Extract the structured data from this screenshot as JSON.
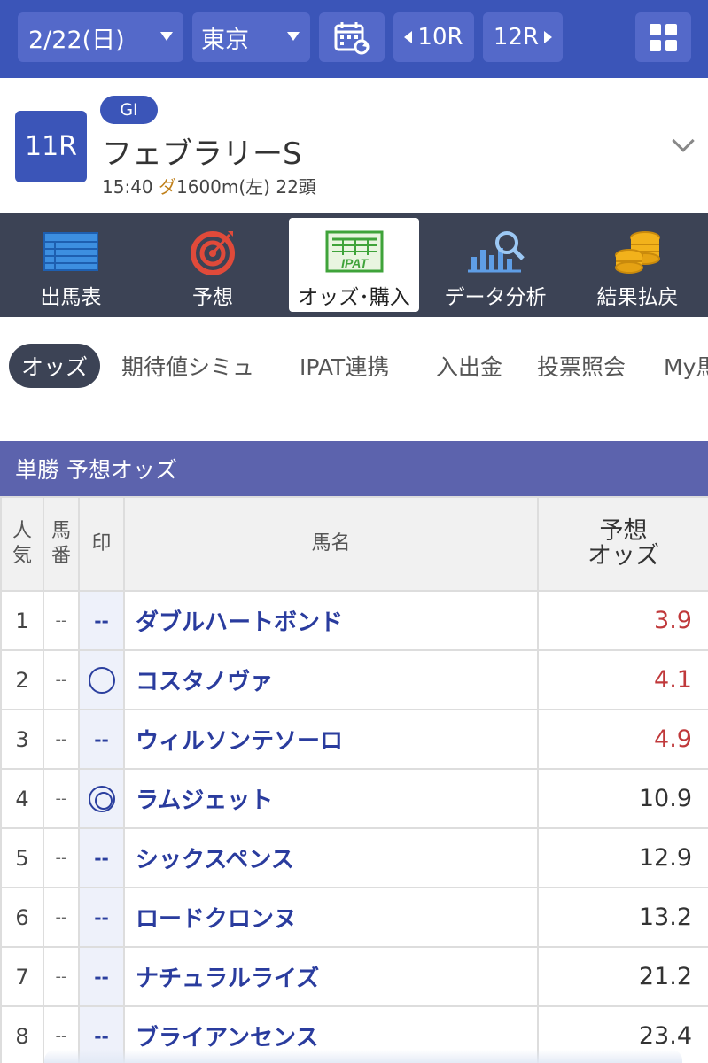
{
  "topbar": {
    "date": "2/22(日)",
    "venue": "東京",
    "prev_race": "10R",
    "next_race": "12R",
    "calendar_icon": "calendar-refresh-icon",
    "menu_icon": "grid-menu-icon"
  },
  "race": {
    "number": "11R",
    "grade": "GI",
    "name": "フェブラリーS",
    "time": "15:40",
    "surface": "ダ",
    "distance": "1600m(左)",
    "runners": "22頭"
  },
  "main_nav": [
    {
      "label": "出馬表",
      "icon": "entry-table-icon",
      "active": false
    },
    {
      "label": "予想",
      "icon": "target-icon",
      "active": false
    },
    {
      "label": "オッズ･購入",
      "icon": "ipat-icon",
      "icon_text": "IPAT",
      "active": true
    },
    {
      "label": "データ分析",
      "icon": "chart-magnifier-icon",
      "active": false
    },
    {
      "label": "結果払戻",
      "icon": "coins-icon",
      "active": false
    }
  ],
  "sub_tabs": [
    {
      "label": "オッズ",
      "active": true
    },
    {
      "label": "期待値シミュ",
      "active": false
    },
    {
      "label": "IPAT連携",
      "active": false
    },
    {
      "label": "入出金",
      "active": false
    },
    {
      "label": "投票照会",
      "active": false
    },
    {
      "label": "My馬",
      "active": false
    }
  ],
  "odds": {
    "title": "単勝 予想オッズ",
    "headers": {
      "popularity": [
        "人",
        "気"
      ],
      "horse_number": [
        "馬",
        "番"
      ],
      "mark": "印",
      "horse_name": "馬名",
      "odds": [
        "予想",
        "オッズ"
      ]
    },
    "rows": [
      {
        "popularity": "1",
        "horse_number": "--",
        "mark": "--",
        "name": "ダブルハートボンド",
        "odds": "3.9",
        "hot": true
      },
      {
        "popularity": "2",
        "horse_number": "--",
        "mark": "circle",
        "name": "コスタノヴァ",
        "odds": "4.1",
        "hot": true
      },
      {
        "popularity": "3",
        "horse_number": "--",
        "mark": "--",
        "name": "ウィルソンテソーロ",
        "odds": "4.9",
        "hot": true
      },
      {
        "popularity": "4",
        "horse_number": "--",
        "mark": "double-circle",
        "name": "ラムジェット",
        "odds": "10.9",
        "hot": false
      },
      {
        "popularity": "5",
        "horse_number": "--",
        "mark": "--",
        "name": "シックスペンス",
        "odds": "12.9",
        "hot": false
      },
      {
        "popularity": "6",
        "horse_number": "--",
        "mark": "--",
        "name": "ロードクロンヌ",
        "odds": "13.2",
        "hot": false
      },
      {
        "popularity": "7",
        "horse_number": "--",
        "mark": "--",
        "name": "ナチュラルライズ",
        "odds": "21.2",
        "hot": false
      },
      {
        "popularity": "8",
        "horse_number": "--",
        "mark": "--",
        "name": "ブライアンセンス",
        "odds": "23.4",
        "hot": false
      }
    ]
  },
  "colors": {
    "brand_blue": "#3b55b8",
    "nav_dark": "#3c4355",
    "section_purple": "#5c63ad",
    "hot_odds_red": "#c0393b",
    "horse_name_blue": "#2a3c9e"
  }
}
